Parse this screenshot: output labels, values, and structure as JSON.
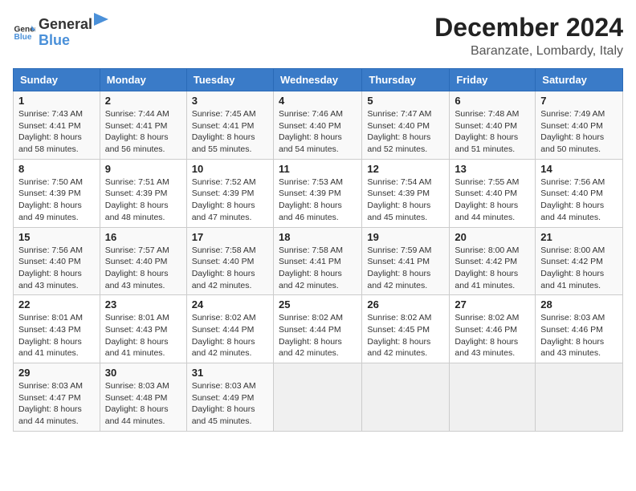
{
  "logo": {
    "general": "General",
    "blue": "Blue"
  },
  "title": "December 2024",
  "subtitle": "Baranzate, Lombardy, Italy",
  "weekdays": [
    "Sunday",
    "Monday",
    "Tuesday",
    "Wednesday",
    "Thursday",
    "Friday",
    "Saturday"
  ],
  "weeks": [
    [
      {
        "day": "1",
        "sunrise": "7:43 AM",
        "sunset": "4:41 PM",
        "daylight": "8 hours and 58 minutes."
      },
      {
        "day": "2",
        "sunrise": "7:44 AM",
        "sunset": "4:41 PM",
        "daylight": "8 hours and 56 minutes."
      },
      {
        "day": "3",
        "sunrise": "7:45 AM",
        "sunset": "4:41 PM",
        "daylight": "8 hours and 55 minutes."
      },
      {
        "day": "4",
        "sunrise": "7:46 AM",
        "sunset": "4:40 PM",
        "daylight": "8 hours and 54 minutes."
      },
      {
        "day": "5",
        "sunrise": "7:47 AM",
        "sunset": "4:40 PM",
        "daylight": "8 hours and 52 minutes."
      },
      {
        "day": "6",
        "sunrise": "7:48 AM",
        "sunset": "4:40 PM",
        "daylight": "8 hours and 51 minutes."
      },
      {
        "day": "7",
        "sunrise": "7:49 AM",
        "sunset": "4:40 PM",
        "daylight": "8 hours and 50 minutes."
      }
    ],
    [
      {
        "day": "8",
        "sunrise": "7:50 AM",
        "sunset": "4:39 PM",
        "daylight": "8 hours and 49 minutes."
      },
      {
        "day": "9",
        "sunrise": "7:51 AM",
        "sunset": "4:39 PM",
        "daylight": "8 hours and 48 minutes."
      },
      {
        "day": "10",
        "sunrise": "7:52 AM",
        "sunset": "4:39 PM",
        "daylight": "8 hours and 47 minutes."
      },
      {
        "day": "11",
        "sunrise": "7:53 AM",
        "sunset": "4:39 PM",
        "daylight": "8 hours and 46 minutes."
      },
      {
        "day": "12",
        "sunrise": "7:54 AM",
        "sunset": "4:39 PM",
        "daylight": "8 hours and 45 minutes."
      },
      {
        "day": "13",
        "sunrise": "7:55 AM",
        "sunset": "4:40 PM",
        "daylight": "8 hours and 44 minutes."
      },
      {
        "day": "14",
        "sunrise": "7:56 AM",
        "sunset": "4:40 PM",
        "daylight": "8 hours and 44 minutes."
      }
    ],
    [
      {
        "day": "15",
        "sunrise": "7:56 AM",
        "sunset": "4:40 PM",
        "daylight": "8 hours and 43 minutes."
      },
      {
        "day": "16",
        "sunrise": "7:57 AM",
        "sunset": "4:40 PM",
        "daylight": "8 hours and 43 minutes."
      },
      {
        "day": "17",
        "sunrise": "7:58 AM",
        "sunset": "4:40 PM",
        "daylight": "8 hours and 42 minutes."
      },
      {
        "day": "18",
        "sunrise": "7:58 AM",
        "sunset": "4:41 PM",
        "daylight": "8 hours and 42 minutes."
      },
      {
        "day": "19",
        "sunrise": "7:59 AM",
        "sunset": "4:41 PM",
        "daylight": "8 hours and 42 minutes."
      },
      {
        "day": "20",
        "sunrise": "8:00 AM",
        "sunset": "4:42 PM",
        "daylight": "8 hours and 41 minutes."
      },
      {
        "day": "21",
        "sunrise": "8:00 AM",
        "sunset": "4:42 PM",
        "daylight": "8 hours and 41 minutes."
      }
    ],
    [
      {
        "day": "22",
        "sunrise": "8:01 AM",
        "sunset": "4:43 PM",
        "daylight": "8 hours and 41 minutes."
      },
      {
        "day": "23",
        "sunrise": "8:01 AM",
        "sunset": "4:43 PM",
        "daylight": "8 hours and 41 minutes."
      },
      {
        "day": "24",
        "sunrise": "8:02 AM",
        "sunset": "4:44 PM",
        "daylight": "8 hours and 42 minutes."
      },
      {
        "day": "25",
        "sunrise": "8:02 AM",
        "sunset": "4:44 PM",
        "daylight": "8 hours and 42 minutes."
      },
      {
        "day": "26",
        "sunrise": "8:02 AM",
        "sunset": "4:45 PM",
        "daylight": "8 hours and 42 minutes."
      },
      {
        "day": "27",
        "sunrise": "8:02 AM",
        "sunset": "4:46 PM",
        "daylight": "8 hours and 43 minutes."
      },
      {
        "day": "28",
        "sunrise": "8:03 AM",
        "sunset": "4:46 PM",
        "daylight": "8 hours and 43 minutes."
      }
    ],
    [
      {
        "day": "29",
        "sunrise": "8:03 AM",
        "sunset": "4:47 PM",
        "daylight": "8 hours and 44 minutes."
      },
      {
        "day": "30",
        "sunrise": "8:03 AM",
        "sunset": "4:48 PM",
        "daylight": "8 hours and 44 minutes."
      },
      {
        "day": "31",
        "sunrise": "8:03 AM",
        "sunset": "4:49 PM",
        "daylight": "8 hours and 45 minutes."
      },
      null,
      null,
      null,
      null
    ]
  ],
  "labels": {
    "sunrise": "Sunrise:",
    "sunset": "Sunset:",
    "daylight": "Daylight:"
  }
}
